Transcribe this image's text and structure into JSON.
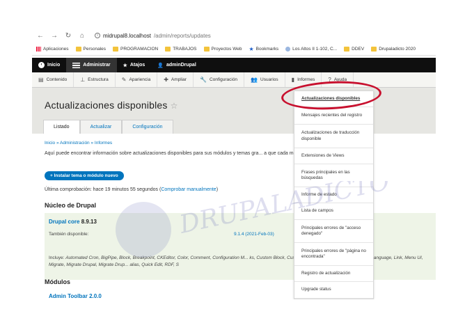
{
  "browser": {
    "url_host": "midrupal8.localhost",
    "url_path": "/admin/reports/updates",
    "bookmarks": [
      {
        "label": "Aplicaciones",
        "icon": "apps-grid-icon"
      },
      {
        "label": "Personales",
        "icon": "folder-icon"
      },
      {
        "label": "PROGRAMACION",
        "icon": "folder-icon"
      },
      {
        "label": "TRABAJOS",
        "icon": "folder-icon"
      },
      {
        "label": "Proyectos Web",
        "icon": "folder-icon"
      },
      {
        "label": "Bookmarks",
        "icon": "star-icon"
      },
      {
        "label": "Los Altos II 1-102, C...",
        "icon": "globe-icon"
      },
      {
        "label": "DDEV",
        "icon": "folder-icon"
      },
      {
        "label": "Drupaladicto 2020",
        "icon": "folder-icon"
      }
    ]
  },
  "toolbar": {
    "home": "Inicio",
    "manage": "Administrar",
    "shortcuts": "Atajos",
    "user": "adminDrupal"
  },
  "tray": {
    "items": [
      {
        "label": "Contenido",
        "icon": "content-icon"
      },
      {
        "label": "Estructura",
        "icon": "structure-icon"
      },
      {
        "label": "Apariencia",
        "icon": "appearance-icon"
      },
      {
        "label": "Ampliar",
        "icon": "extend-icon"
      },
      {
        "label": "Configuración",
        "icon": "wrench-icon"
      },
      {
        "label": "Usuarios",
        "icon": "users-icon"
      },
      {
        "label": "Informes",
        "icon": "reports-icon"
      },
      {
        "label": "Ayuda",
        "icon": "help-icon"
      }
    ]
  },
  "page": {
    "title": "Actualizaciones disponibles",
    "tabs": [
      "Listado",
      "Actualizar",
      "Configuración"
    ],
    "breadcrumb": "Inicio » Administración » Informes",
    "intro": "Aquí puede encontrar información sobre actualizaciones disponibles para sus módulos y temas gra... a que cada módulo o ter en su interior.",
    "install_button": "+ Instalar tema o módulo nuevo",
    "last_check_prefix": "Última comprobación: hace 19 minutos 55 segundos (",
    "last_check_link": "Comprobar manualmente",
    "last_check_suffix": ")",
    "core_heading": "Núcleo de Drupal",
    "core_name": "Drupal core",
    "core_version": "8.9.13",
    "also_available": "También disponible:",
    "also_version": "9.1.4 (2021-Feb-03)",
    "includes_label": "Incluye:",
    "includes_list": "Automated Cron, BigPipe, Block, Breakpoint, CKEditor, Color, Comment, Configuration M... ks, Custom Block, Custo Page Cache, Internal Page Cache, Language, Link, Menu UI, Migrate, Migrate Drupal, Migrate Drup... alias, Quick Edit, RDF, S",
    "modules_heading": "Módulos",
    "module_cut": "Admin Toolbar 2.0.0"
  },
  "reports_menu": [
    "Actualizaciones disponibles",
    "Mensajes recientes del registro",
    "Actualizaciones de traducción disponible",
    "Extensiones de Views",
    "Frases principales en las búsquedas",
    "Informe de estado",
    "Lista de campos",
    "Principales errores de \"acceso denegado\"",
    "Principales errores de \"página no encontrada\"",
    "Registro de actualización",
    "Upgrade status"
  ],
  "watermark_text": "DRUPALADICTO",
  "colors": {
    "link": "#0074bd",
    "toolbar_bg": "#0f0f0f",
    "highlight": "#c8102e",
    "core_bg": "#eef4e7"
  }
}
